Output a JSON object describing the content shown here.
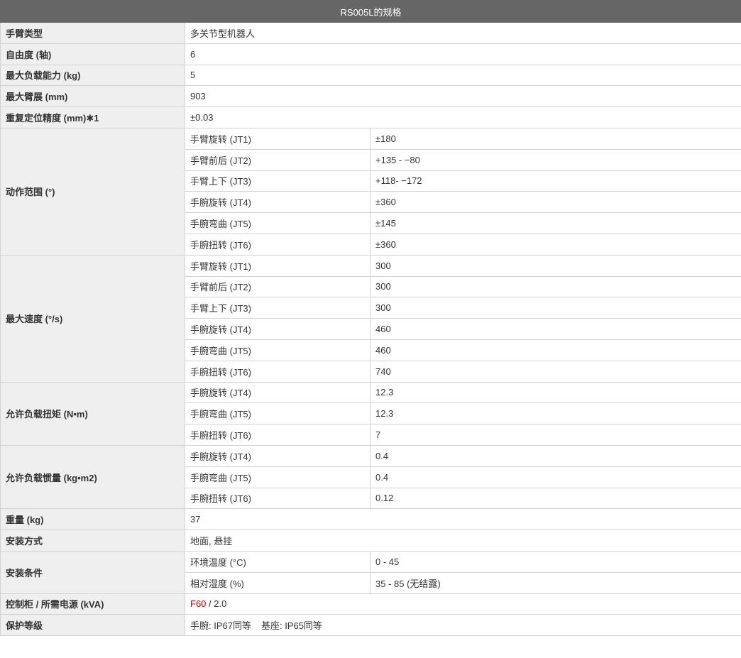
{
  "title": "RS005L的规格",
  "accent_color": "#cc0000",
  "header_color": "#666666",
  "simple_rows": {
    "arm_type": {
      "label": "手臂类型",
      "value": "多关节型机器人"
    },
    "dof": {
      "label": "自由度 (轴)",
      "value": "6"
    },
    "payload": {
      "label": "最大负载能力 (kg)",
      "value": "5"
    },
    "reach": {
      "label": "最大臂展 (mm)",
      "value": "903"
    },
    "repeatability": {
      "label": "重复定位精度 (mm)✱1",
      "value": "±0.03"
    },
    "weight": {
      "label": "重量 (kg)",
      "value": "37"
    },
    "mounting": {
      "label": "安装方式",
      "value": "地面, 悬挂"
    }
  },
  "motion_range": {
    "label": "动作范围 (°)",
    "rows": [
      {
        "axis": "手臂旋转 (JT1)",
        "value": "±180"
      },
      {
        "axis": "手臂前后 (JT2)",
        "value": "+135 - −80"
      },
      {
        "axis": "手臂上下 (JT3)",
        "value": "+118- −172"
      },
      {
        "axis": "手腕旋转 (JT4)",
        "value": "±360"
      },
      {
        "axis": "手腕弯曲 (JT5)",
        "value": "±145"
      },
      {
        "axis": "手腕扭转 (JT6)",
        "value": "±360"
      }
    ]
  },
  "max_speed": {
    "label": "最大速度 (°/s)",
    "rows": [
      {
        "axis": "手臂旋转 (JT1)",
        "value": "300"
      },
      {
        "axis": "手臂前后 (JT2)",
        "value": "300"
      },
      {
        "axis": "手臂上下 (JT3)",
        "value": "300"
      },
      {
        "axis": "手腕旋转 (JT4)",
        "value": "460"
      },
      {
        "axis": "手腕弯曲 (JT5)",
        "value": "460"
      },
      {
        "axis": "手腕扭转 (JT6)",
        "value": "740"
      }
    ]
  },
  "allowable_torque": {
    "label": "允许负载扭矩 (N•m)",
    "rows": [
      {
        "axis": "手腕旋转 (JT4)",
        "value": "12.3"
      },
      {
        "axis": "手腕弯曲 (JT5)",
        "value": "12.3"
      },
      {
        "axis": "手腕扭转 (JT6)",
        "value": "7"
      }
    ]
  },
  "allowable_inertia": {
    "label": "允许负载惯量 (kg•m2)",
    "rows": [
      {
        "axis": "手腕旋转 (JT4)",
        "value": "0.4"
      },
      {
        "axis": "手腕弯曲 (JT5)",
        "value": "0.4"
      },
      {
        "axis": "手腕扭转 (JT6)",
        "value": "0.12"
      }
    ]
  },
  "install_conditions": {
    "label": "安装条件",
    "rows": [
      {
        "axis": "环境温度 (°C)",
        "value": "0 - 45"
      },
      {
        "axis": "相对湿度 (%)",
        "value": "35 - 85 (无结露)"
      }
    ]
  },
  "controller": {
    "label": "控制柜 / 所需电源 (kVA)",
    "link": "F60",
    "rest": " / 2.0"
  },
  "protection": {
    "label": "保护等级",
    "wrist": "手腕: IP67同等",
    "base": "基座: IP65同等"
  }
}
